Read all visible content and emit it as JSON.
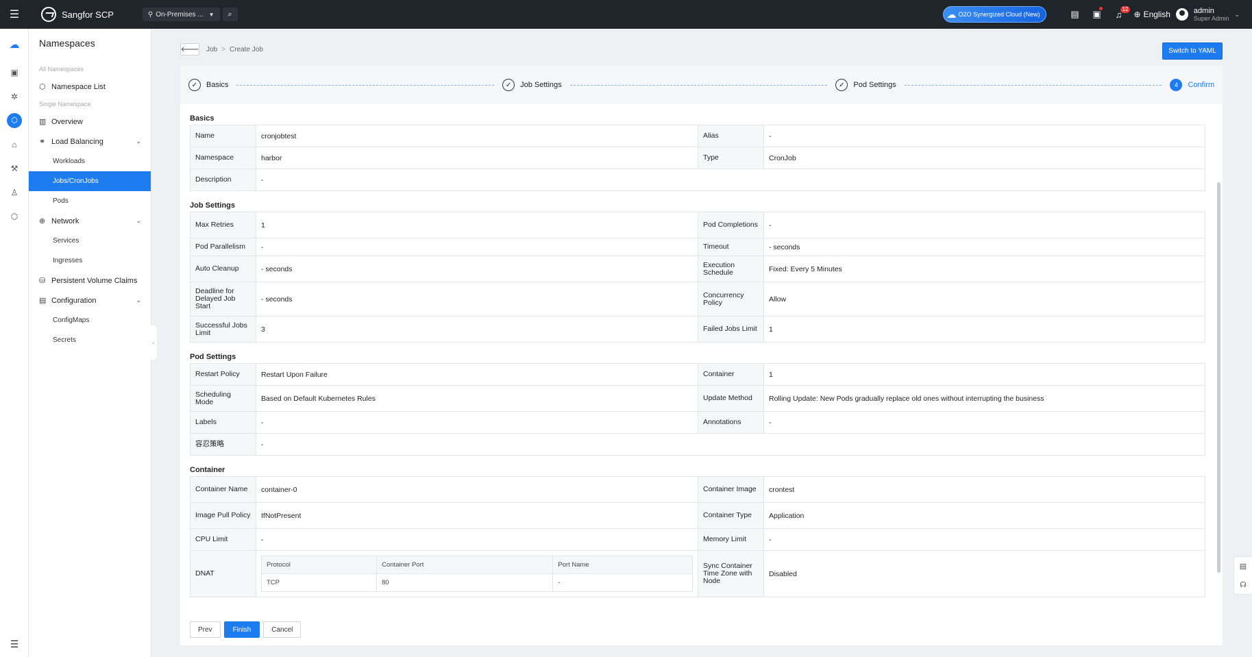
{
  "topbar": {
    "menu_icon": "hamburger-icon",
    "app_name": "Sangfor SCP",
    "scope_label": "On-Premises ...",
    "o2o_label": "O2O Synergized Cloud (New)",
    "notification_count": "12",
    "language": "English",
    "user_name": "admin",
    "user_role": "Super Admin"
  },
  "nav": {
    "title": "Namespaces",
    "group_all": "All Namespaces",
    "namespace_list": "Namespace List",
    "group_single": "Single Namespace",
    "overview": "Overview",
    "load_balancing": "Load Balancing",
    "workloads": "Workloads",
    "jobs": "Jobs/CronJobs",
    "pods": "Pods",
    "network": "Network",
    "services": "Services",
    "ingresses": "Ingresses",
    "pvc": "Persistent Volume Claims",
    "configuration": "Configuration",
    "configmaps": "ConfigMaps",
    "secrets": "Secrets"
  },
  "breadcrumb": {
    "parent": "Job",
    "sep": ">",
    "current": "Create Job"
  },
  "switch_yaml": "Switch to YAML",
  "steps": [
    {
      "label": "Basics",
      "mark": "✓"
    },
    {
      "label": "Job Settings",
      "mark": "✓"
    },
    {
      "label": "Pod Settings",
      "mark": "✓"
    },
    {
      "label": "Confirm",
      "mark": "4"
    }
  ],
  "basics": {
    "title": "Basics",
    "name_k": "Name",
    "name_v": "cronjobtest",
    "alias_k": "Alias",
    "alias_v": "-",
    "ns_k": "Namespace",
    "ns_v": "harbor",
    "type_k": "Type",
    "type_v": "CronJob",
    "desc_k": "Description",
    "desc_v": "-"
  },
  "job": {
    "title": "Job Settings",
    "retries_k": "Max Retries",
    "retries_v": "1",
    "completions_k": "Pod Completions",
    "completions_v": "-",
    "parallel_k": "Pod Parallelism",
    "parallel_v": "-",
    "timeout_k": "Timeout",
    "timeout_v": "- seconds",
    "cleanup_k": "Auto Cleanup",
    "cleanup_v": "- seconds",
    "schedule_k": "Execution Schedule",
    "schedule_v": "Fixed: Every 5 Minutes",
    "deadline_k": "Deadline for Delayed Job Start",
    "deadline_v": "- seconds",
    "concurrency_k": "Concurrency Policy",
    "concurrency_v": "Allow",
    "success_k": "Successful Jobs Limit",
    "success_v": "3",
    "failed_k": "Failed Jobs Limit",
    "failed_v": "1"
  },
  "pod": {
    "title": "Pod Settings",
    "restart_k": "Restart Policy",
    "restart_v": "Restart Upon Failure",
    "container_k": "Container",
    "container_v": "1",
    "sched_k": "Scheduling Mode",
    "sched_v": "Based on Default Kubernetes Rules",
    "update_k": "Update Method",
    "update_v": "Rolling Update: New Pods gradually replace old ones without interrupting the business",
    "labels_k": "Labels",
    "labels_v": "-",
    "annot_k": "Annotations",
    "annot_v": "-",
    "tol_k": "容忍策略",
    "tol_v": "-"
  },
  "container": {
    "title": "Container",
    "name_k": "Container Name",
    "name_v": "container-0",
    "image_k": "Container Image",
    "image_v": "crontest",
    "pull_k": "Image Pull Policy",
    "pull_v": "IfNotPresent",
    "ctype_k": "Container Type",
    "ctype_v": "Application",
    "cpu_k": "CPU Limit",
    "cpu_v": "-",
    "mem_k": "Memory Limit",
    "mem_v": "-",
    "dnat_k": "DNAT",
    "ports_headers": [
      "Protocol",
      "Container Port",
      "Port Name"
    ],
    "ports_rows": [
      [
        "TCP",
        "80",
        "-"
      ]
    ],
    "tz_k": "Sync Container Time Zone with Node",
    "tz_v": "Disabled"
  },
  "footer": {
    "prev": "Prev",
    "finish": "Finish",
    "cancel": "Cancel"
  },
  "colors": {
    "accent": "#1d7df0",
    "topbar": "#20242b"
  }
}
